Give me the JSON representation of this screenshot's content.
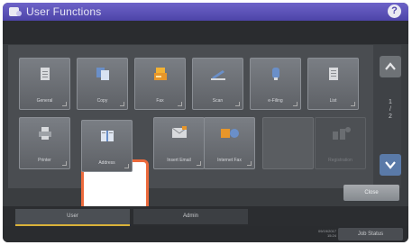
{
  "window": {
    "title": "User Functions",
    "help_label": "?"
  },
  "tiles": [
    {
      "label": "General",
      "icon": "document-icon"
    },
    {
      "label": "Copy",
      "icon": "copy-icon"
    },
    {
      "label": "Fax",
      "icon": "fax-icon"
    },
    {
      "label": "Scan",
      "icon": "scanner-icon"
    },
    {
      "label": "e-Filing",
      "icon": "e-filing-icon"
    },
    {
      "label": "List",
      "icon": "list-icon"
    },
    {
      "label": "Printer",
      "icon": "printer-icon"
    },
    {
      "label": "Address",
      "icon": "address-book-icon"
    },
    {
      "label": "Insert Email",
      "icon": "insert-email-icon"
    },
    {
      "label": "Internet Fax",
      "icon": "internet-fax-icon"
    },
    {
      "label": "",
      "icon": ""
    },
    {
      "label": "Registration",
      "icon": "registration-icon"
    }
  ],
  "scroll": {
    "page_current": "1",
    "page_total": "2"
  },
  "close_label": "Close",
  "tabs": [
    {
      "label": "User"
    },
    {
      "label": "Admin"
    }
  ],
  "footer": {
    "date": "09/19/2017",
    "time": "15:24",
    "job_status_label": "Job Status"
  },
  "colors": {
    "title_bar": "#5a50b8",
    "highlight": "#ec6a3c",
    "active_tab_underline": "#d9b23a"
  }
}
